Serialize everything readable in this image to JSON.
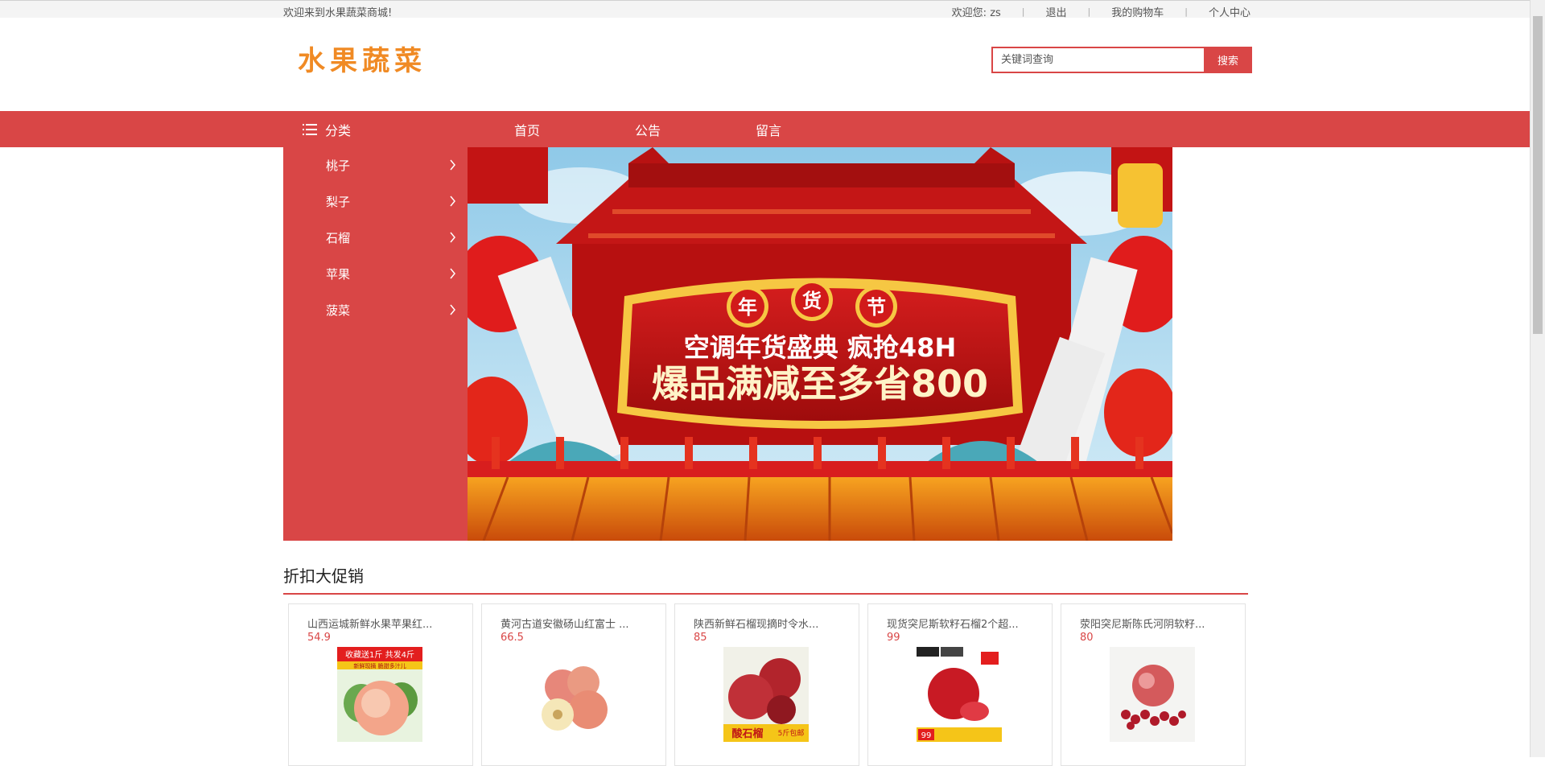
{
  "topbar": {
    "welcome": "欢迎来到水果蔬菜商城!",
    "user_greeting": "欢迎您:",
    "username": "zs",
    "logout": "退出",
    "cart": "我的购物车",
    "profile": "个人中心"
  },
  "header": {
    "logo_text": "水果蔬菜",
    "search_placeholder": "关键词查询",
    "search_button": "搜索"
  },
  "nav": {
    "category_label": "分类",
    "items": [
      "首页",
      "公告",
      "留言"
    ]
  },
  "sidebar": {
    "categories": [
      "桃子",
      "梨子",
      "石榴",
      "苹果",
      "菠菜"
    ]
  },
  "banner": {
    "badge": "年货节",
    "badge_chars": [
      "年",
      "货",
      "节"
    ],
    "headline": "空调年货盛典 疯抢48H",
    "subline": "爆品满减至多省800"
  },
  "promo": {
    "title": "折扣大促销",
    "products": [
      {
        "name": "山西运城新鲜水果苹果红...",
        "price": "54.9",
        "img_top": "收藏送1斤 共发4斤",
        "img_sub": "新鲜现摘 脆甜多汁儿"
      },
      {
        "name": "黄河古道安徽砀山红富士 ...",
        "price": "66.5"
      },
      {
        "name": "陕西新鲜石榴现摘时令水...",
        "price": "85",
        "img_tag": "酸石榴",
        "img_tag2": "5斤包邮"
      },
      {
        "name": "现货突尼斯软籽石榴2个超...",
        "price": "99",
        "img_num": "99"
      },
      {
        "name": "荥阳突尼斯陈氏河阴软籽...",
        "price": "80"
      }
    ]
  },
  "colors": {
    "accent": "#d94646",
    "logo": "#f08a24"
  }
}
